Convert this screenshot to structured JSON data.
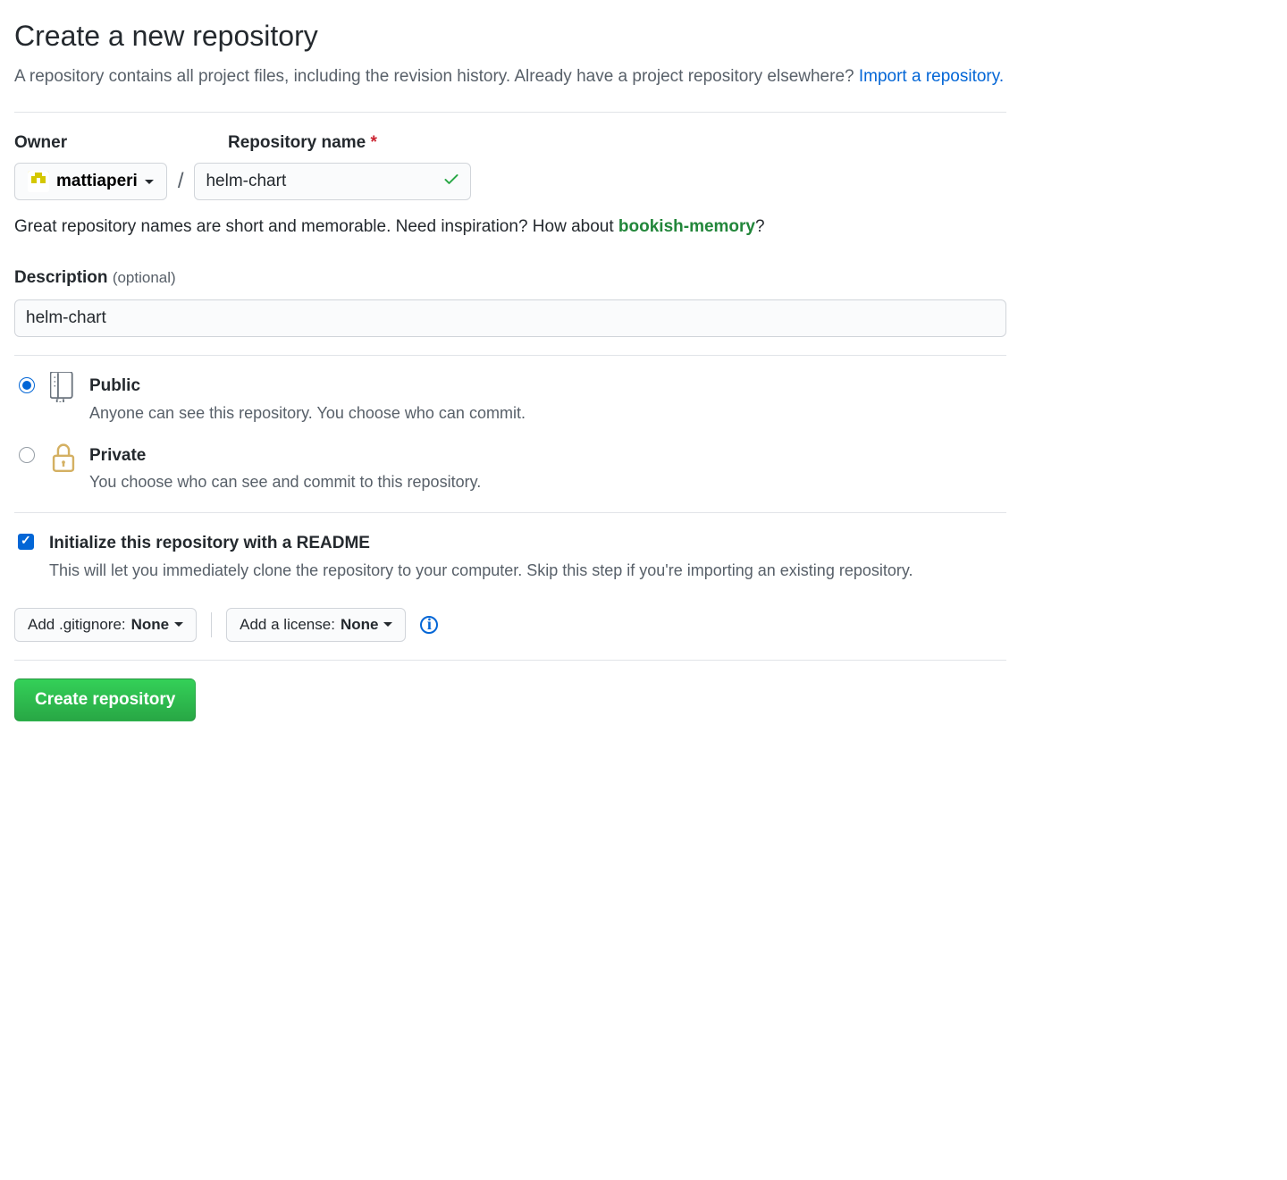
{
  "title": "Create a new repository",
  "subtitle_1": "A repository contains all project files, including the revision history. Already have a project repository elsewhere? ",
  "import_link": "Import a repository.",
  "labels": {
    "owner": "Owner",
    "repo_name": "Repository name",
    "required_mark": "*",
    "description": "Description",
    "optional": "(optional)"
  },
  "owner": {
    "name": "mattiaperi"
  },
  "repo_name": {
    "value": "helm-chart"
  },
  "hint_1": "Great repository names are short and memorable. Need inspiration? How about ",
  "hint_suggestion": "bookish-memory",
  "hint_q": "?",
  "description_value": "helm-chart",
  "visibility": {
    "public": {
      "title": "Public",
      "desc": "Anyone can see this repository. You choose who can commit."
    },
    "private": {
      "title": "Private",
      "desc": "You choose who can see and commit to this repository."
    }
  },
  "readme": {
    "title": "Initialize this repository with a README",
    "desc": "This will let you immediately clone the repository to your computer. Skip this step if you're importing an existing repository."
  },
  "gitignore": {
    "label": "Add .gitignore: ",
    "value": "None"
  },
  "license": {
    "label": "Add a license: ",
    "value": "None"
  },
  "submit": "Create repository"
}
